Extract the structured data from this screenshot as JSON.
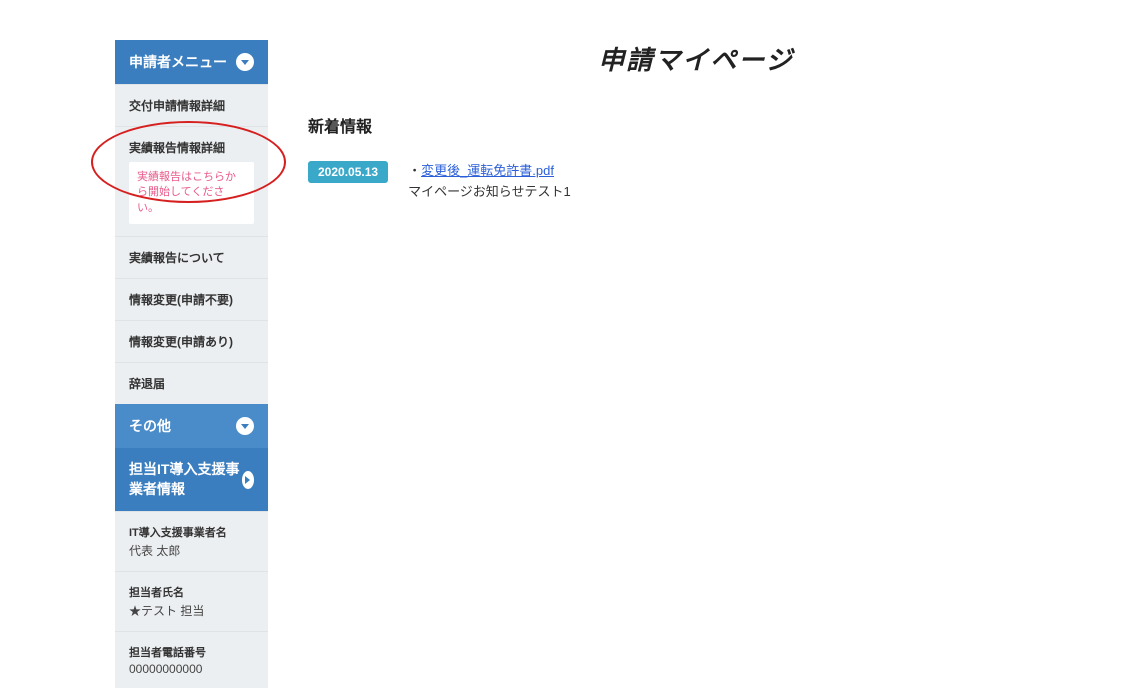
{
  "sidebar": {
    "menu1": {
      "title": "申請者メニュー",
      "items": [
        {
          "label": "交付申請情報詳細"
        },
        {
          "label": "実績報告情報詳細",
          "notice": "実績報告はこちらから開始してください。"
        },
        {
          "label": "実績報告について"
        },
        {
          "label": "情報変更(申請不要)"
        },
        {
          "label": "情報変更(申請あり)"
        },
        {
          "label": "辞退届"
        }
      ]
    },
    "menu2": {
      "title": "その他"
    },
    "menu3": {
      "title": "担当IT導入支援事業者情報",
      "company_label": "IT導入支援事業者名",
      "company_value": "代表 太郎",
      "person_label": "担当者氏名",
      "person_value": "★テスト 担当",
      "phone_label": "担当者電話番号",
      "phone_value": "00000000000"
    }
  },
  "main": {
    "title": "申請マイページ",
    "section_title": "新着情報",
    "news": {
      "date": "2020.05.13",
      "link_text": "変更後_運転免許書.pdf",
      "body": "マイページお知らせテスト1"
    }
  }
}
